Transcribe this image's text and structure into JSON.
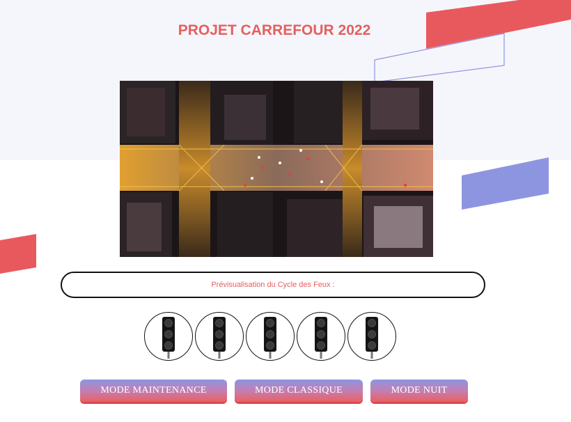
{
  "page": {
    "title": "PROJET CARREFOUR 2022"
  },
  "hero_image": {
    "description_icon": "aerial-city-intersection-photo"
  },
  "preview": {
    "label": "Prévisualisation du Cycle des Feux :"
  },
  "traffic_lights": {
    "count": 5,
    "icon": "traffic-light-icon"
  },
  "buttons": {
    "maintenance": "MODE MAINTENANCE",
    "classique": "MODE CLASSIQUE",
    "nuit": "MODE NUIT"
  },
  "colors": {
    "accent_red": "#e3605f",
    "accent_blue": "#8e95e0",
    "background": "#ffffff"
  }
}
